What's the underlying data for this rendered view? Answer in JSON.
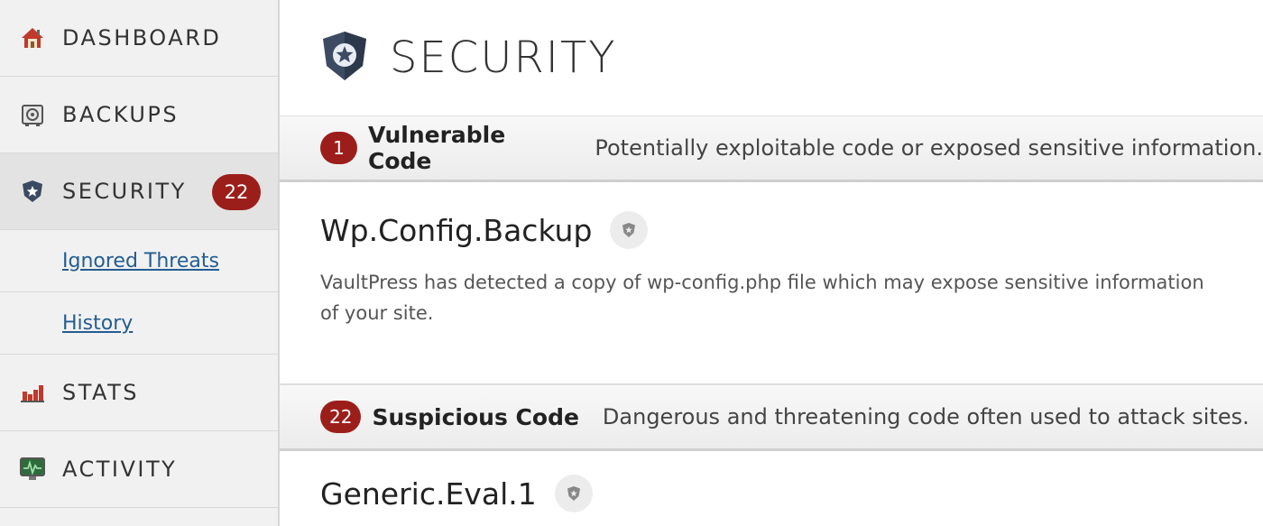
{
  "sidebar": {
    "items": [
      {
        "label": "DASHBOARD",
        "icon": "house-icon"
      },
      {
        "label": "BACKUPS",
        "icon": "vault-icon"
      },
      {
        "label": "SECURITY",
        "icon": "shield-star-icon",
        "badge": "22",
        "active": true
      },
      {
        "label": "STATS",
        "icon": "bar-chart-icon"
      },
      {
        "label": "ACTIVITY",
        "icon": "monitor-activity-icon"
      }
    ],
    "sub_items": [
      {
        "label": "Ignored Threats"
      },
      {
        "label": "History"
      }
    ]
  },
  "main": {
    "title": "SECURITY",
    "sections": [
      {
        "count": "1",
        "name": "Vulnerable Code",
        "description": "Potentially exploitable code or exposed sensitive information.",
        "threats": [
          {
            "title": "Wp.Config.Backup",
            "description": "VaultPress has detected a copy of wp-config.php file which may expose sensitive information of your site."
          }
        ]
      },
      {
        "count": "22",
        "name": "Suspicious Code",
        "description": "Dangerous and threatening code often used to attack sites.",
        "threats": [
          {
            "title": "Generic.Eval.1"
          }
        ]
      }
    ]
  },
  "colors": {
    "badge": "#9c1e1b",
    "link": "#245d92",
    "sidebar_bg": "#f1f1f1",
    "active_bg": "#e3e3e3"
  }
}
